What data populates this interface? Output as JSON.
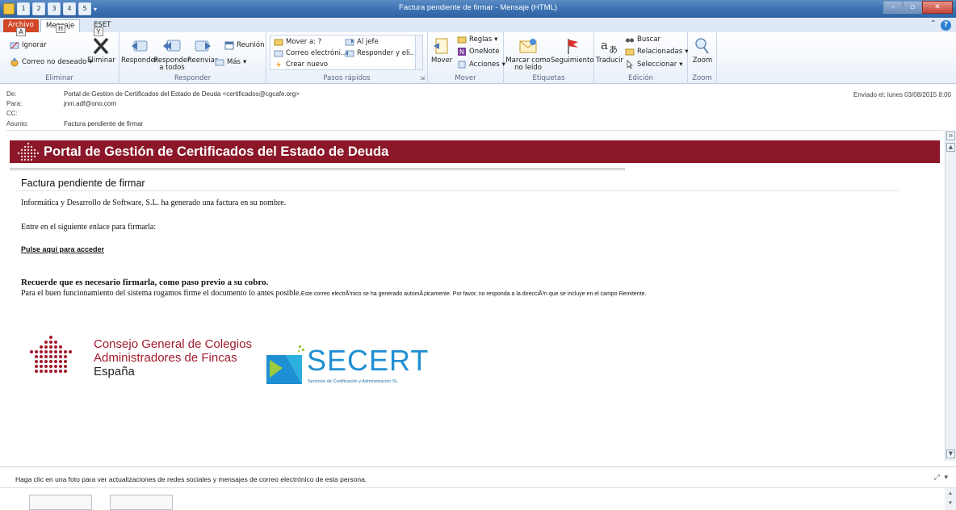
{
  "window": {
    "title": "Factura pendiente de firmar - Mensaje (HTML)",
    "qat_keys": [
      "1",
      "2",
      "3",
      "4",
      "5"
    ]
  },
  "tabs": {
    "file": "Archivo",
    "message": "Mensaje",
    "eset": "ESET",
    "keytips": [
      "A",
      "H",
      "Y"
    ]
  },
  "ribbon": {
    "delete_group": {
      "label": "Eliminar",
      "ignore": "Ignorar",
      "junk": "Correo no deseado",
      "delete": "Eliminar"
    },
    "respond_group": {
      "label": "Responder",
      "reply": "Responder",
      "reply_all": "Responder a todos",
      "forward": "Reenviar",
      "meeting": "Reunión",
      "more": "Más"
    },
    "quick_group": {
      "label": "Pasos rápidos",
      "items": [
        "Mover a: ?",
        "Correo electróni...",
        "Crear nuevo",
        "Al jefe",
        "Responder y eli..."
      ]
    },
    "move_group": {
      "label": "Mover",
      "move": "Mover",
      "rules": "Reglas",
      "onenote": "OneNote",
      "actions": "Acciones"
    },
    "tags_group": {
      "label": "Etiquetas",
      "mark_unread": "Marcar como no leído",
      "followup": "Seguimiento"
    },
    "edit_group": {
      "label": "Edición",
      "translate": "Traducir",
      "find": "Buscar",
      "related": "Relacionadas",
      "select": "Seleccionar"
    },
    "zoom_group": {
      "label": "Zoom",
      "zoom": "Zoom"
    }
  },
  "header": {
    "from_label": "De:",
    "from_value": "Portal de Gestion de Certificados del Estado de Deuda <certificados@cgcafe.org>",
    "to_label": "Para:",
    "to_value": "jnm.adf@ono.com",
    "cc_label": "CC:",
    "subject_label": "Asunto:",
    "subject_value": "Factura pendiente de firmar",
    "sent": "Enviado el:  lunes 03/08/2015 8:00"
  },
  "body": {
    "banner_title": "Portal de Gestión de Certificados del Estado de Deuda",
    "heading": "Factura pendiente de firmar",
    "line1": "Informática y Desarrollo de Software, S.L. ha generado una factura en su nombre.",
    "line2": "Entre en el siguiente enlace para firmarla:",
    "link": "Pulse aquí para acceder",
    "reminder": "Recuerde que es necesario firmarla, como paso previo a su cobro.",
    "line3": "Para el buen funcionamiento del sistema rogamos firme el documento lo antes posible.",
    "line3_small": "Este correo electrÃ³nico se ha generado automÃ¡ticamente. Por favor, no responda a la direcciÃ³n que se incluye en el campo Remitente.",
    "logo1_lines": [
      "Consejo General de Colegios",
      "Administradores de Fincas",
      "España"
    ],
    "logo2_name": "SECERT",
    "logo2_tagline": "Servicios de Certificación y Administración SL"
  },
  "people_pane": {
    "message": "Haga clic en una foto para ver actualizaciones de redes sociales y mensajes de correo electrónico de esta persona."
  },
  "colors": {
    "banner": "#8b1728",
    "accent": "#1f8fd3",
    "file_tab": "#d24726"
  }
}
